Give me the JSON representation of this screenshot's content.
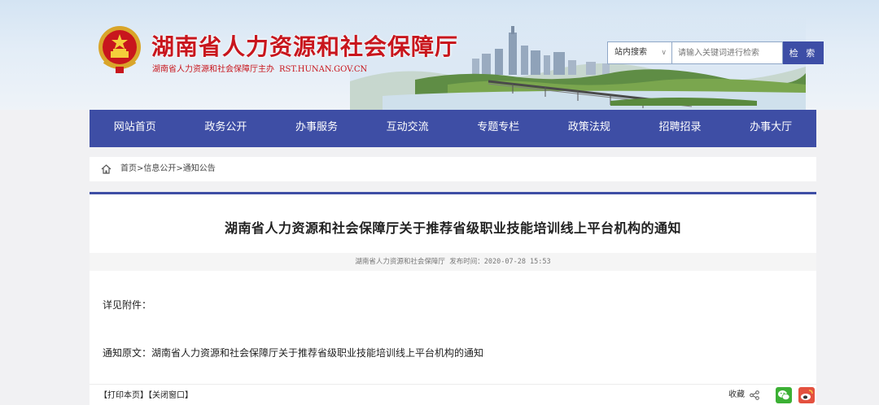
{
  "header": {
    "title": "湖南省人力资源和社会保障厅",
    "subtitle": "湖南省人力资源和社会保障厅主办",
    "url_text": "RST.HUNAN.GOV.CN"
  },
  "search": {
    "scope": "站内搜索",
    "placeholder": "请输入关键词进行检索",
    "button": "检 索"
  },
  "nav": {
    "items": [
      "网站首页",
      "政务公开",
      "办事服务",
      "互动交流",
      "专题专栏",
      "政策法规",
      "招聘招录",
      "办事大厅"
    ]
  },
  "breadcrumb": {
    "home": "首页",
    "sep": ">",
    "level1": "信息公开",
    "level2": "通知公告"
  },
  "article": {
    "title": "湖南省人力资源和社会保障厅关于推荐省级职业技能培训线上平台机构的通知",
    "source": "湖南省人力资源和社会保障厅",
    "time_label": "发布时间：",
    "time": "2020-07-28 15:53",
    "para1": "详见附件：",
    "para2_prefix": "通知原文：",
    "para2_link": "湖南省人力资源和社会保障厅关于推荐省级职业技能培训线上平台机构的通知"
  },
  "footer": {
    "print": "【打印本页】",
    "close": "【关闭窗口】",
    "favorite": "收藏"
  },
  "colors": {
    "brand_blue": "#3e4ea5",
    "title_red": "#c8161d",
    "wechat_green": "#3cb034",
    "weibo_red": "#e4513f"
  },
  "icons": [
    "emblem-icon",
    "home-icon",
    "share-icon",
    "wechat-icon",
    "weibo-icon",
    "chevron-down-icon"
  ]
}
